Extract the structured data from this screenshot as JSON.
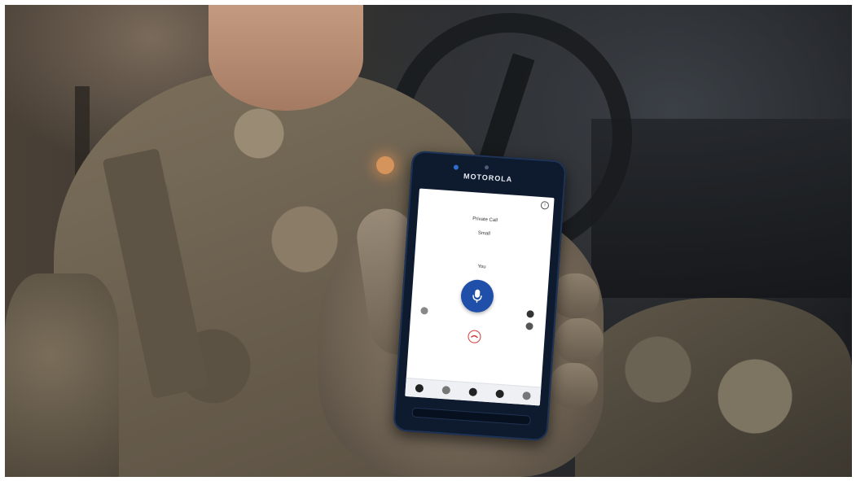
{
  "photo": {
    "subject": "soldier-holding-phone",
    "phone": {
      "brand": "MOTOROLA",
      "screen": {
        "call_type": "Private Call",
        "caller": "Small",
        "speaker": "You"
      },
      "icons": {
        "info": "info-icon",
        "push_to_talk": "microphone-icon",
        "end_call": "hang-up-icon"
      },
      "accent_color": "#1f4fa8",
      "end_call_color": "#d23a3a"
    }
  }
}
